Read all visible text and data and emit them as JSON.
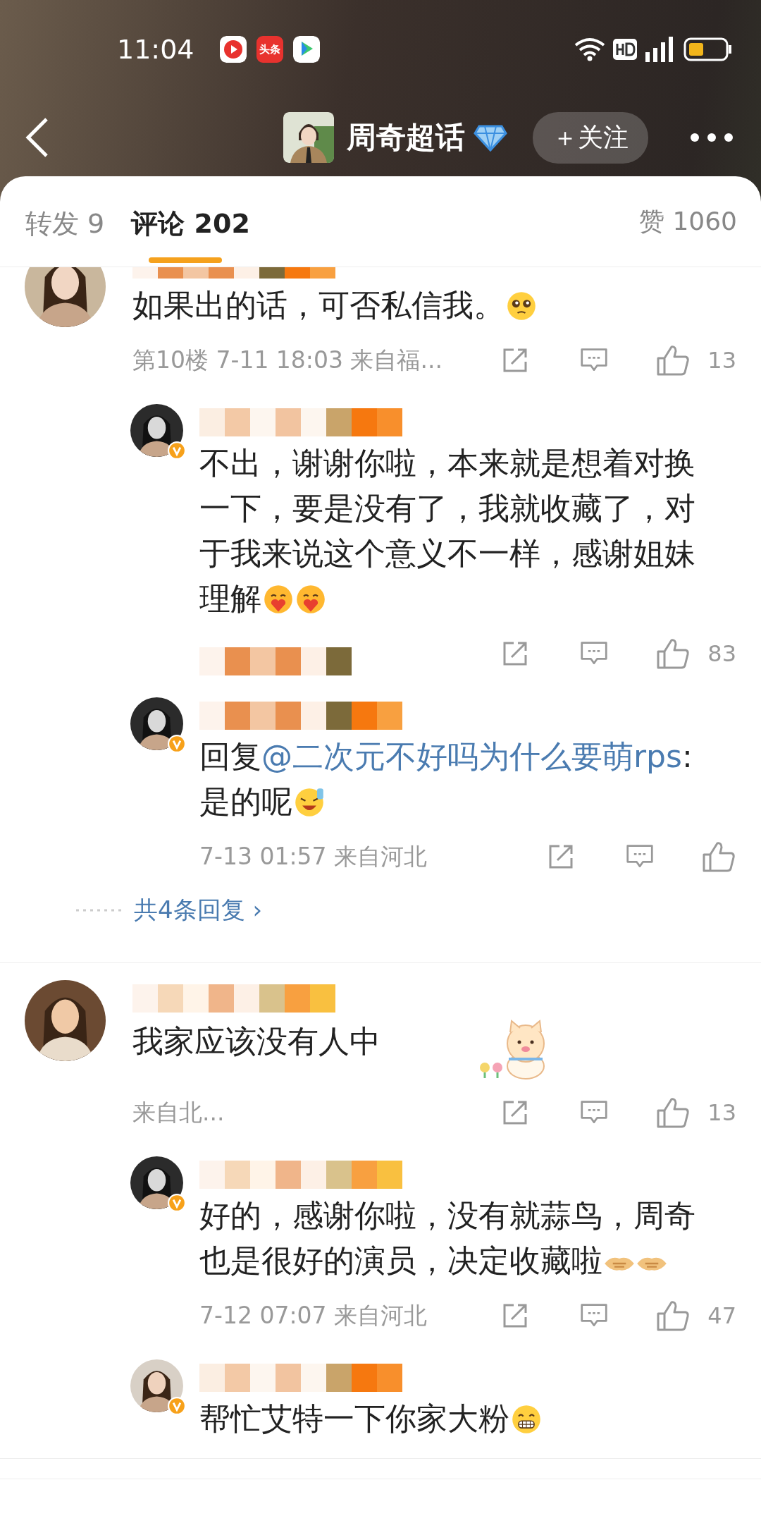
{
  "status_bar": {
    "time": "11:04",
    "app_icons": [
      {
        "kind": "video"
      },
      {
        "kind": "news",
        "label": "头条"
      },
      {
        "kind": "tv"
      }
    ]
  },
  "nav": {
    "title": "周奇超话",
    "follow": "＋关注"
  },
  "tabs": [
    {
      "label": "转发 9",
      "selected": false
    },
    {
      "label": "评论 202",
      "selected": true
    }
  ],
  "likes_total": "赞 1060",
  "comments": [
    {
      "text": "如果出的话，可否私信我。",
      "emojis": [
        {
          "kind": "pleading"
        }
      ],
      "meta": "第10楼 7-11 18:03 来自福...",
      "likes": "13",
      "more": "共4条回复",
      "more_arrow": "›",
      "replies": [
        {
          "verified": true,
          "text": "不出，谢谢你啦，本来就是想着对换一下，要是没有了，我就收藏了，对于我来说这个意义不一样，感谢姐妹理解",
          "emojis": [
            {
              "kind": "hug"
            },
            {
              "kind": "hug"
            }
          ],
          "likes": "83"
        },
        {
          "verified": true,
          "prefix": "回复",
          "mention": "@二次元不好吗为什么要萌rps",
          "text": ":是的呢",
          "emojis": [
            {
              "kind": "sweat-laugh"
            }
          ],
          "meta": "7-13 01:57 来自河北"
        }
      ]
    },
    {
      "text": "我家应该没有人中",
      "emojis": [
        {
          "kind": "cat-sticker"
        }
      ],
      "meta": "来自北...",
      "likes": "13",
      "replies": [
        {
          "verified": true,
          "text": "好的，感谢你啦，没有就蒜鸟，周奇也是很好的演员，决定收藏啦",
          "emojis": [
            {
              "kind": "handshake"
            },
            {
              "kind": "handshake"
            }
          ],
          "meta": "7-12 07:07 来自河北",
          "likes": "47"
        },
        {
          "verified": true,
          "text": "帮忙艾特一下你家大粉",
          "emojis": [
            {
              "kind": "grin"
            }
          ]
        }
      ]
    }
  ]
}
